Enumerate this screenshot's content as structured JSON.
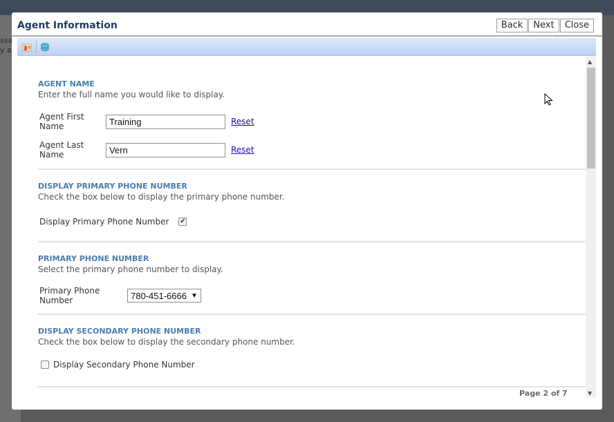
{
  "background": {
    "text_1": "ssa",
    "text_2": "y a"
  },
  "dialog": {
    "title": "Agent Information",
    "buttons": {
      "back": "Back",
      "next": "Next",
      "close": "Close"
    },
    "toolbar": {
      "icons": [
        "agent-profile-icon",
        "database-icon"
      ]
    }
  },
  "sections": {
    "agent_name": {
      "title": "AGENT NAME",
      "description": "Enter the full name you would like to display.",
      "first_name_label": "Agent First Name",
      "first_name_value": "Training",
      "last_name_label": "Agent Last Name",
      "last_name_value": "Vern",
      "reset_label": "Reset"
    },
    "display_primary": {
      "title": "DISPLAY PRIMARY PHONE NUMBER",
      "description": "Check the box below to display the primary phone number.",
      "checkbox_label": "Display Primary Phone Number",
      "checked": true
    },
    "primary_phone": {
      "title": "PRIMARY PHONE NUMBER",
      "description": "Select the primary phone number to display.",
      "select_label": "Primary Phone Number",
      "select_value": "780-451-6666"
    },
    "display_secondary": {
      "title": "DISPLAY SECONDARY PHONE NUMBER",
      "description": "Check the box below to display the secondary phone number.",
      "checkbox_label": "Display Secondary Phone Number",
      "checked": false
    }
  },
  "footer": {
    "page_indicator": "Page 2 of 7"
  },
  "colors": {
    "section_title": "#4a7cad",
    "link": "#1a0dab",
    "dialog_title": "#1f3a5f"
  }
}
